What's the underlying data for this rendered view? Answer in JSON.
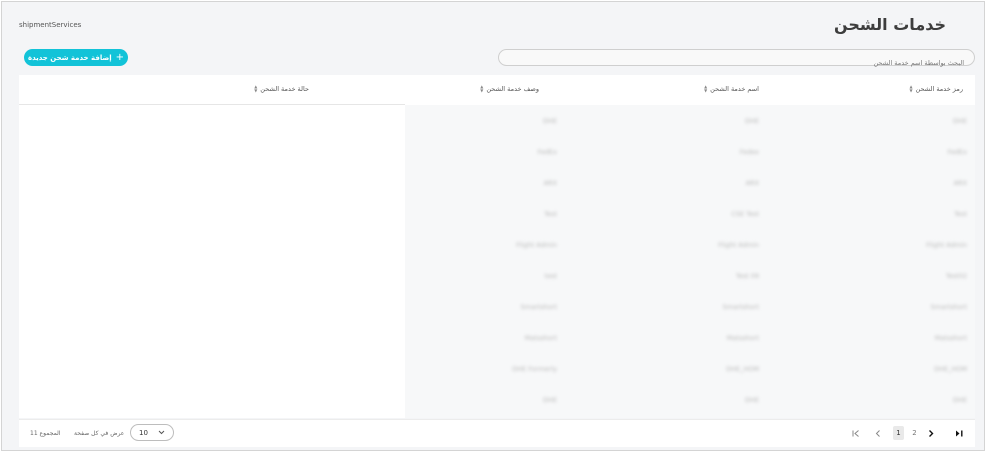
{
  "breadcrumb": "shipmentServices",
  "page_title": "خدمات الشحن",
  "add_button_label": "إضافة خدمة شحن جديدة",
  "search": {
    "placeholder": "البحث بواسطة اسم خدمة الشحن",
    "value": ""
  },
  "columns": [
    {
      "key": "code",
      "label": "رمز خدمة الشحن"
    },
    {
      "key": "name",
      "label": "اسم خدمة الشحن"
    },
    {
      "key": "desc",
      "label": "وصف خدمة الشحن"
    },
    {
      "key": "status",
      "label": "حالة خدمة الشحن"
    }
  ],
  "rows": [
    {
      "code": "DHE",
      "name": "DHE",
      "desc": "DHE"
    },
    {
      "code": "FedEx",
      "name": "Fedex",
      "desc": "FedEx"
    },
    {
      "code": "ARX",
      "name": "ARX",
      "desc": "ARX"
    },
    {
      "code": "Test",
      "name": "CSE Test",
      "desc": "Test"
    },
    {
      "code": "Flight Admin",
      "name": "Flight Admin",
      "desc": "Flight Admin"
    },
    {
      "code": "Test02",
      "name": "Test 09",
      "desc": "test"
    },
    {
      "code": "Smartshort",
      "name": "Smartshort",
      "desc": "Smartshort"
    },
    {
      "code": "Matsshort",
      "name": "Matsshort",
      "desc": "Matsshort"
    },
    {
      "code": "DHE_HOM",
      "name": "DHE_HOM",
      "desc": "DHE Formerly"
    },
    {
      "code": "DHE",
      "name": "DHE",
      "desc": "DHE"
    }
  ],
  "footer": {
    "total_label": "المجموع 11",
    "per_page_label": "عرض في كل صفحة",
    "per_page_value": "10",
    "pages": [
      "1",
      "2"
    ],
    "current_page": "1"
  },
  "icons": {
    "plus": "plus-icon",
    "sort": "sort-icon",
    "chevron": "chevron-down-icon",
    "first": "first-page-icon",
    "prev": "prev-page-icon",
    "next": "next-page-icon",
    "last": "last-page-icon"
  },
  "colors": {
    "accent": "#12c3d8",
    "background": "#f4f5f7"
  }
}
